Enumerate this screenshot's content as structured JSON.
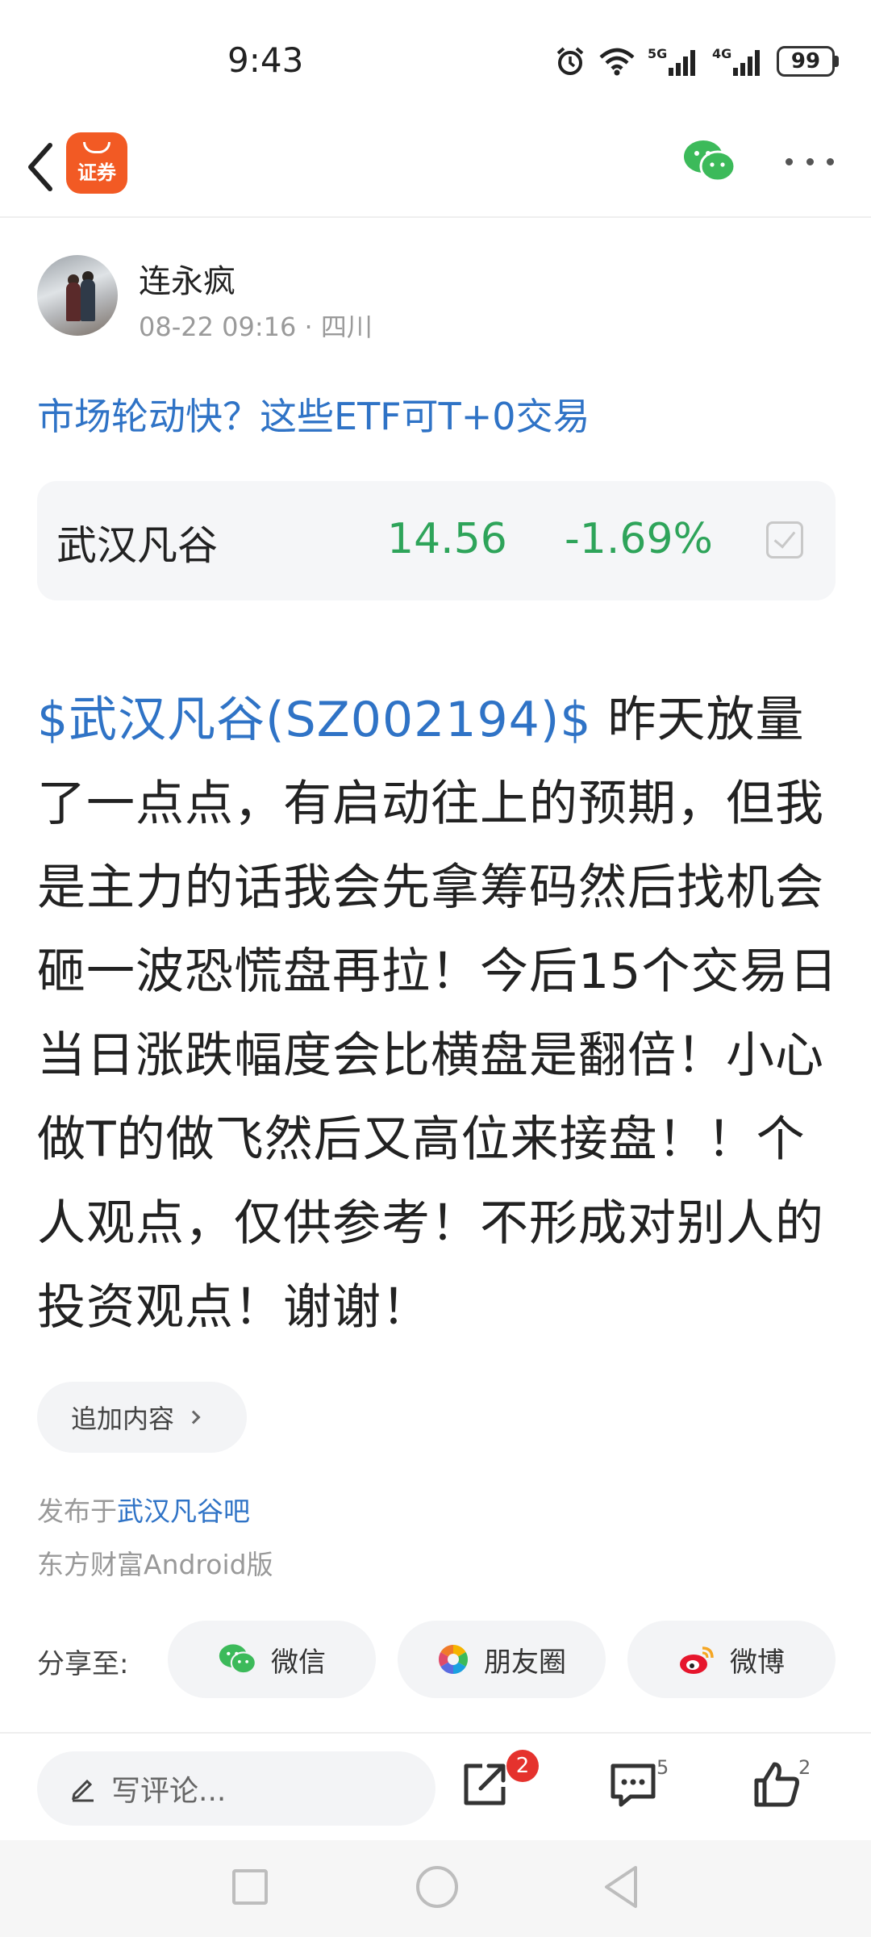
{
  "status_bar": {
    "time": "9:43",
    "network_5g": "5G",
    "network_4g": "4G",
    "battery": "99"
  },
  "top_nav": {
    "app_logo_text": "证券"
  },
  "author": {
    "name": "连永疯",
    "meta": "08-22 09:16 · 四川"
  },
  "related_link": "市场轮动快？这些ETF可T+0交易",
  "stock_card": {
    "name": "武汉凡谷",
    "price": "14.56",
    "change": "-1.69%",
    "change_color": "#2ea45a"
  },
  "post": {
    "stock_tag": "$武汉凡谷(SZ002194)$",
    "text": "  昨天放量了一点点，有启动往上的预期，但我是主力的话我会先拿筹码然后找机会砸一波恐慌盘再拉！今后15个交易日当日涨跌幅度会比横盘是翻倍！小心做T的做飞然后又高位来接盘！！个人观点，仅供参考！不形成对别人的投资观点！谢谢！"
  },
  "append_button": "追加内容",
  "publish": {
    "prefix": "发布于",
    "bar_name": "武汉凡谷吧",
    "client": "东方财富Android版"
  },
  "share": {
    "label": "分享至:",
    "wechat": "微信",
    "moments": "朋友圈",
    "weibo": "微博"
  },
  "bottom_bar": {
    "comment_placeholder": "写评论...",
    "share_badge": "2",
    "comment_count": "5",
    "like_count": "2"
  },
  "colors": {
    "link_blue": "#2f73c6",
    "stock_green": "#2ea45a",
    "brand_orange": "#f25a24",
    "badge_red": "#e5322d"
  }
}
